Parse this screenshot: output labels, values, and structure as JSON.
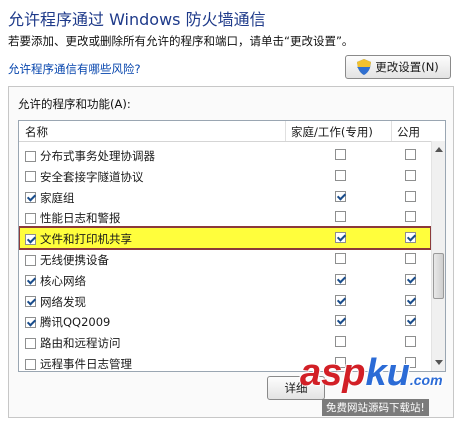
{
  "window": {
    "title": "允许程序通过 Windows 防火墙通信",
    "subtitle": "若要添加、更改或删除所有允许的程序和端口，请单击“更改设置”。",
    "risk_link": "允许程序通信有哪些风险?",
    "change_settings_label": "更改设置(N)",
    "group_label": "允许的程序和功能(A):",
    "details_label": "详细"
  },
  "table": {
    "columns": [
      "名称",
      "家庭/工作(专用)",
      "公用"
    ],
    "rows": [
      {
        "name": "分布式事务处理协调器",
        "enabled": false,
        "home": false,
        "public": false
      },
      {
        "name": "安全套接字隧道协议",
        "enabled": false,
        "home": false,
        "public": false
      },
      {
        "name": "家庭组",
        "enabled": true,
        "home": true,
        "public": false
      },
      {
        "name": "性能日志和警报",
        "enabled": false,
        "home": false,
        "public": false
      },
      {
        "name": "文件和打印机共享",
        "enabled": true,
        "home": true,
        "public": true,
        "highlighted": true
      },
      {
        "name": "无线便携设备",
        "enabled": false,
        "home": false,
        "public": false
      },
      {
        "name": "核心网络",
        "enabled": true,
        "home": true,
        "public": true
      },
      {
        "name": "网络发现",
        "enabled": true,
        "home": true,
        "public": true
      },
      {
        "name": "腾讯QQ2009",
        "enabled": true,
        "home": true,
        "public": true
      },
      {
        "name": "路由和远程访问",
        "enabled": false,
        "home": false,
        "public": false
      },
      {
        "name": "远程事件日志管理",
        "enabled": false,
        "home": false,
        "public": false
      }
    ]
  },
  "watermark": {
    "main_a": "asp",
    "main_b": "ku",
    "suffix": ".com",
    "sub": "免费网站源码下载站!"
  },
  "colors": {
    "title": "#1e3a8a",
    "link": "#0645ad",
    "highlight": "#fffe3c",
    "highlight_border": "#8b3a3a"
  }
}
